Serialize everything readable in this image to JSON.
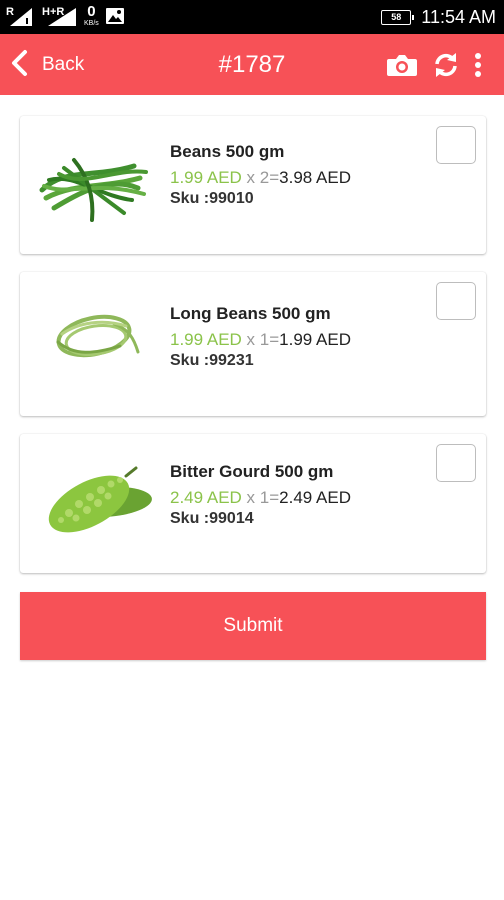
{
  "status_bar": {
    "sim1_label": "R",
    "sim2_label": "H+R",
    "speed_value": "0",
    "speed_unit": "KB/s",
    "battery": "58",
    "time": "11:54 AM"
  },
  "header": {
    "back_label": "Back",
    "title": "#1787",
    "color": "#f75157"
  },
  "items": [
    {
      "name": "Beans 500 gm",
      "price": "1.99 AED",
      "qty_text": " x 2=",
      "total": "3.98 AED",
      "sku": "Sku :99010",
      "checked": false
    },
    {
      "name": "Long Beans 500 gm",
      "price": "1.99 AED",
      "qty_text": " x 1=",
      "total": "1.99 AED",
      "sku": "Sku :99231",
      "checked": false
    },
    {
      "name": "Bitter Gourd 500 gm",
      "price": "2.49 AED",
      "qty_text": " x 1=",
      "total": "2.49 AED",
      "sku": "Sku :99014",
      "checked": false
    }
  ],
  "submit_label": "Submit",
  "icons": [
    "back-chevron-icon",
    "camera-icon",
    "refresh-icon",
    "more-vert-icon",
    "gallery-icon"
  ],
  "colors": {
    "accent": "#f75157",
    "price_green": "#8bc34a"
  }
}
